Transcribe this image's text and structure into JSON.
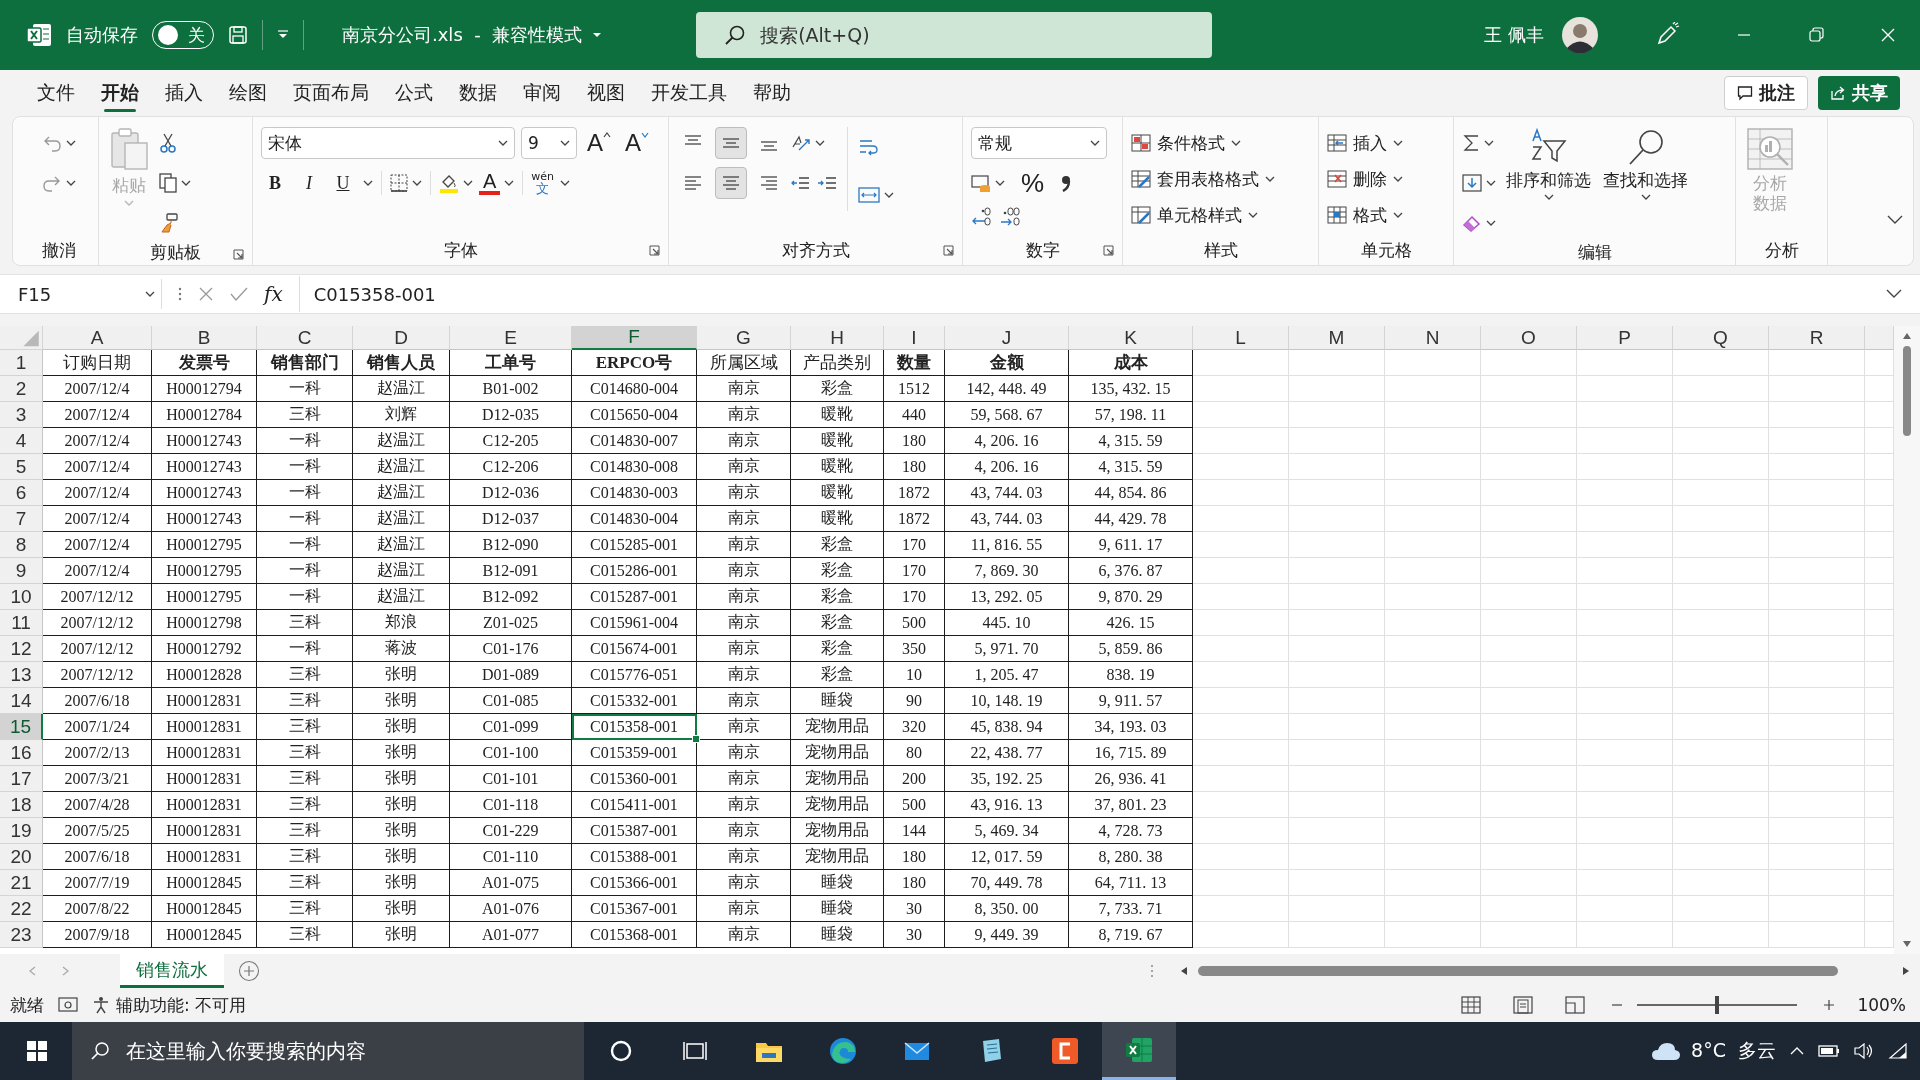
{
  "title_bar": {
    "autosave_label": "自动保存",
    "autosave_toggle": {
      "on": false,
      "label": "关"
    },
    "file_name": "南京分公司.xls  -  兼容性模式",
    "search": {
      "placeholder": "搜索(Alt+Q)"
    },
    "user_name": "王 佩丰"
  },
  "menu_tabs": [
    {
      "label": "文件",
      "selected": false
    },
    {
      "label": "开始",
      "selected": true
    },
    {
      "label": "插入",
      "selected": false
    },
    {
      "label": "绘图",
      "selected": false
    },
    {
      "label": "页面布局",
      "selected": false
    },
    {
      "label": "公式",
      "selected": false
    },
    {
      "label": "数据",
      "selected": false
    },
    {
      "label": "审阅",
      "selected": false
    },
    {
      "label": "视图",
      "selected": false
    },
    {
      "label": "开发工具",
      "selected": false
    },
    {
      "label": "帮助",
      "selected": false
    }
  ],
  "comment_button": "批注",
  "share_button": "共享",
  "ribbon": {
    "groups": [
      {
        "kind": "undo",
        "label": "撤消"
      },
      {
        "kind": "clipboard",
        "label": "剪贴板",
        "paste": {
          "label": "粘贴",
          "disabled": true
        }
      },
      {
        "kind": "font",
        "label": "字体",
        "font_name": "宋体",
        "font_size": "9",
        "size_buttons": [
          "A",
          "A"
        ],
        "style_buttons": [
          "B",
          "I",
          "U"
        ],
        "font_color": "A",
        "phonetic": [
          "wén",
          "文"
        ]
      },
      {
        "kind": "alignment",
        "label": "对齐方式"
      },
      {
        "kind": "number",
        "label": "数字",
        "format": "常规",
        "percent": "%"
      },
      {
        "kind": "styles",
        "label": "样式",
        "items": [
          "条件格式",
          "套用表格格式",
          "单元格样式"
        ]
      },
      {
        "kind": "cells",
        "label": "单元格",
        "items": [
          "插入",
          "删除",
          "格式"
        ]
      },
      {
        "kind": "editing",
        "label": "编辑",
        "items": [
          "排序和筛选",
          "查找和选择"
        ]
      },
      {
        "kind": "analysis",
        "label": "分析",
        "items": [
          {
            "label": "分析数据",
            "disabled": true
          }
        ]
      }
    ]
  },
  "formula_bar": {
    "name_box": "F15",
    "function_label": "fx",
    "formula": "C015358-001"
  },
  "sheet": {
    "columns": [
      {
        "letter": "A",
        "selected": false
      },
      {
        "letter": "B",
        "selected": false
      },
      {
        "letter": "C",
        "selected": false
      },
      {
        "letter": "D",
        "selected": false
      },
      {
        "letter": "E",
        "selected": false
      },
      {
        "letter": "F",
        "selected": true
      },
      {
        "letter": "G",
        "selected": false
      },
      {
        "letter": "H",
        "selected": false
      },
      {
        "letter": "I",
        "selected": false
      },
      {
        "letter": "J",
        "selected": false
      },
      {
        "letter": "K",
        "selected": false
      },
      {
        "letter": "L",
        "selected": false
      },
      {
        "letter": "M",
        "selected": false
      },
      {
        "letter": "N",
        "selected": false
      },
      {
        "letter": "O",
        "selected": false
      },
      {
        "letter": "P",
        "selected": false
      },
      {
        "letter": "Q",
        "selected": false
      },
      {
        "letter": "R",
        "selected": false
      }
    ],
    "header_row": {
      "number": "1",
      "selected": false,
      "cells": [
        {
          "text": "订购日期",
          "bold": false
        },
        {
          "text": "发票号",
          "bold": true
        },
        {
          "text": "销售部门",
          "bold": true
        },
        {
          "text": "销售人员",
          "bold": true
        },
        {
          "text": "工单号",
          "bold": true
        },
        {
          "text": "ERPCO号",
          "bold": true
        },
        {
          "text": "所属区域",
          "bold": false
        },
        {
          "text": "产品类别",
          "bold": false
        },
        {
          "text": "数量",
          "bold": true
        },
        {
          "text": "金额",
          "bold": true
        },
        {
          "text": "成本",
          "bold": true
        }
      ]
    },
    "rows": [
      {
        "number": "2",
        "selected": false,
        "cells": [
          "2007/12/4",
          "H00012794",
          "一科",
          "赵温江",
          "B01-002",
          "C014680-004",
          "南京",
          "彩盒",
          "1512",
          "142, 448. 49",
          "135, 432. 15"
        ]
      },
      {
        "number": "3",
        "selected": false,
        "cells": [
          "2007/12/4",
          "H00012784",
          "三科",
          "刘辉",
          "D12-035",
          "C015650-004",
          "南京",
          "暖靴",
          "440",
          "59, 568. 67",
          "57, 198. 11"
        ]
      },
      {
        "number": "4",
        "selected": false,
        "cells": [
          "2007/12/4",
          "H00012743",
          "一科",
          "赵温江",
          "C12-205",
          "C014830-007",
          "南京",
          "暖靴",
          "180",
          "4, 206. 16",
          "4, 315. 59"
        ]
      },
      {
        "number": "5",
        "selected": false,
        "cells": [
          "2007/12/4",
          "H00012743",
          "一科",
          "赵温江",
          "C12-206",
          "C014830-008",
          "南京",
          "暖靴",
          "180",
          "4, 206. 16",
          "4, 315. 59"
        ]
      },
      {
        "number": "6",
        "selected": false,
        "cells": [
          "2007/12/4",
          "H00012743",
          "一科",
          "赵温江",
          "D12-036",
          "C014830-003",
          "南京",
          "暖靴",
          "1872",
          "43, 744. 03",
          "44, 854. 86"
        ]
      },
      {
        "number": "7",
        "selected": false,
        "cells": [
          "2007/12/4",
          "H00012743",
          "一科",
          "赵温江",
          "D12-037",
          "C014830-004",
          "南京",
          "暖靴",
          "1872",
          "43, 744. 03",
          "44, 429. 78"
        ]
      },
      {
        "number": "8",
        "selected": false,
        "cells": [
          "2007/12/4",
          "H00012795",
          "一科",
          "赵温江",
          "B12-090",
          "C015285-001",
          "南京",
          "彩盒",
          "170",
          "11, 816. 55",
          "9, 611. 17"
        ]
      },
      {
        "number": "9",
        "selected": false,
        "cells": [
          "2007/12/4",
          "H00012795",
          "一科",
          "赵温江",
          "B12-091",
          "C015286-001",
          "南京",
          "彩盒",
          "170",
          "7, 869. 30",
          "6, 376. 87"
        ]
      },
      {
        "number": "10",
        "selected": false,
        "cells": [
          "2007/12/12",
          "H00012795",
          "一科",
          "赵温江",
          "B12-092",
          "C015287-001",
          "南京",
          "彩盒",
          "170",
          "13, 292. 05",
          "9, 870. 29"
        ]
      },
      {
        "number": "11",
        "selected": false,
        "cells": [
          "2007/12/12",
          "H00012798",
          "三科",
          "郑浪",
          "Z01-025",
          "C015961-004",
          "南京",
          "彩盒",
          "500",
          "445. 10",
          "426. 15"
        ]
      },
      {
        "number": "12",
        "selected": false,
        "cells": [
          "2007/12/12",
          "H00012792",
          "一科",
          "蒋波",
          "C01-176",
          "C015674-001",
          "南京",
          "彩盒",
          "350",
          "5, 971. 70",
          "5, 859. 86"
        ]
      },
      {
        "number": "13",
        "selected": false,
        "cells": [
          "2007/12/12",
          "H00012828",
          "三科",
          "张明",
          "D01-089",
          "C015776-051",
          "南京",
          "彩盒",
          "10",
          "1, 205. 47",
          "838. 19"
        ]
      },
      {
        "number": "14",
        "selected": false,
        "cells": [
          "2007/6/18",
          "H00012831",
          "三科",
          "张明",
          "C01-085",
          "C015332-001",
          "南京",
          "睡袋",
          "90",
          "10, 148. 19",
          "9, 911. 57"
        ]
      },
      {
        "number": "15",
        "selected": true,
        "cells": [
          "2007/1/24",
          "H00012831",
          "三科",
          "张明",
          "C01-099",
          "C015358-001",
          "南京",
          "宠物用品",
          "320",
          "45, 838. 94",
          "34, 193. 03"
        ]
      },
      {
        "number": "16",
        "selected": false,
        "cells": [
          "2007/2/13",
          "H00012831",
          "三科",
          "张明",
          "C01-100",
          "C015359-001",
          "南京",
          "宠物用品",
          "80",
          "22, 438. 77",
          "16, 715. 89"
        ]
      },
      {
        "number": "17",
        "selected": false,
        "cells": [
          "2007/3/21",
          "H00012831",
          "三科",
          "张明",
          "C01-101",
          "C015360-001",
          "南京",
          "宠物用品",
          "200",
          "35, 192. 25",
          "26, 936. 41"
        ]
      },
      {
        "number": "18",
        "selected": false,
        "cells": [
          "2007/4/28",
          "H00012831",
          "三科",
          "张明",
          "C01-118",
          "C015411-001",
          "南京",
          "宠物用品",
          "500",
          "43, 916. 13",
          "37, 801. 23"
        ]
      },
      {
        "number": "19",
        "selected": false,
        "cells": [
          "2007/5/25",
          "H00012831",
          "三科",
          "张明",
          "C01-229",
          "C015387-001",
          "南京",
          "宠物用品",
          "144",
          "5, 469. 34",
          "4, 728. 73"
        ]
      },
      {
        "number": "20",
        "selected": false,
        "cells": [
          "2007/6/18",
          "H00012831",
          "三科",
          "张明",
          "C01-110",
          "C015388-001",
          "南京",
          "宠物用品",
          "180",
          "12, 017. 59",
          "8, 280. 38"
        ]
      },
      {
        "number": "21",
        "selected": false,
        "cells": [
          "2007/7/19",
          "H00012845",
          "三科",
          "张明",
          "A01-075",
          "C015366-001",
          "南京",
          "睡袋",
          "180",
          "70, 449. 78",
          "64, 711. 13"
        ]
      },
      {
        "number": "22",
        "selected": false,
        "cells": [
          "2007/8/22",
          "H00012845",
          "三科",
          "张明",
          "A01-076",
          "C015367-001",
          "南京",
          "睡袋",
          "30",
          "8, 350. 00",
          "7, 733. 71"
        ]
      },
      {
        "number": "23",
        "selected": false,
        "cells": [
          "2007/9/18",
          "H00012845",
          "三科",
          "张明",
          "A01-077",
          "C015368-001",
          "南京",
          "睡袋",
          "30",
          "9, 449. 39",
          "8, 719. 67"
        ]
      }
    ]
  },
  "sheet_tabs": [
    {
      "label": "销售流水",
      "selected": true
    }
  ],
  "status_bar": {
    "mode": "就绪",
    "accessibility": "辅助功能: 不可用",
    "zoom_slider": {
      "level": 0.5
    },
    "zoom": "100%"
  },
  "taskbar": {
    "search": {
      "placeholder": "在这里输入你要搜索的内容"
    },
    "apps": [
      {
        "kind": "cortana",
        "active": false
      },
      {
        "kind": "taskview",
        "active": false
      },
      {
        "kind": "explorer",
        "active": false
      },
      {
        "kind": "edge",
        "active": false
      },
      {
        "kind": "mail",
        "active": false
      },
      {
        "kind": "notes",
        "active": false
      },
      {
        "kind": "recorder",
        "active": false
      },
      {
        "kind": "excel",
        "active": true
      }
    ],
    "weather": "8°C  多云"
  }
}
